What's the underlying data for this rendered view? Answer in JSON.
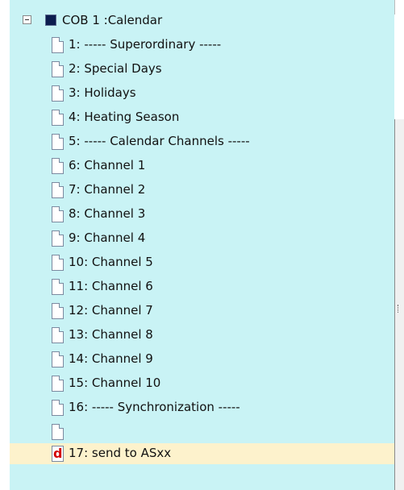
{
  "tree": {
    "root_label": "COB 1 :Calendar",
    "items": [
      {
        "label": "1: ----- Superordinary -----"
      },
      {
        "label": "2: Special Days"
      },
      {
        "label": "3: Holidays"
      },
      {
        "label": "4: Heating Season"
      },
      {
        "label": "5: ----- Calendar Channels -----"
      },
      {
        "label": "6: Channel 1"
      },
      {
        "label": "7: Channel 2"
      },
      {
        "label": "8: Channel 3"
      },
      {
        "label": "9: Channel 4"
      },
      {
        "label": "10: Channel 5"
      },
      {
        "label": "11: Channel 6"
      },
      {
        "label": "12: Channel 7"
      },
      {
        "label": "13: Channel 8"
      },
      {
        "label": "14: Channel 9"
      },
      {
        "label": "15: Channel 10"
      },
      {
        "label": "16: ----- Synchronization -----"
      }
    ],
    "selected_item": {
      "label": "17: send to ASxx",
      "icon_letter": "d"
    }
  },
  "colors": {
    "tree_background": "#c9f3f5",
    "selected_background": "#fdf2cc",
    "d_icon": "#d40000"
  }
}
